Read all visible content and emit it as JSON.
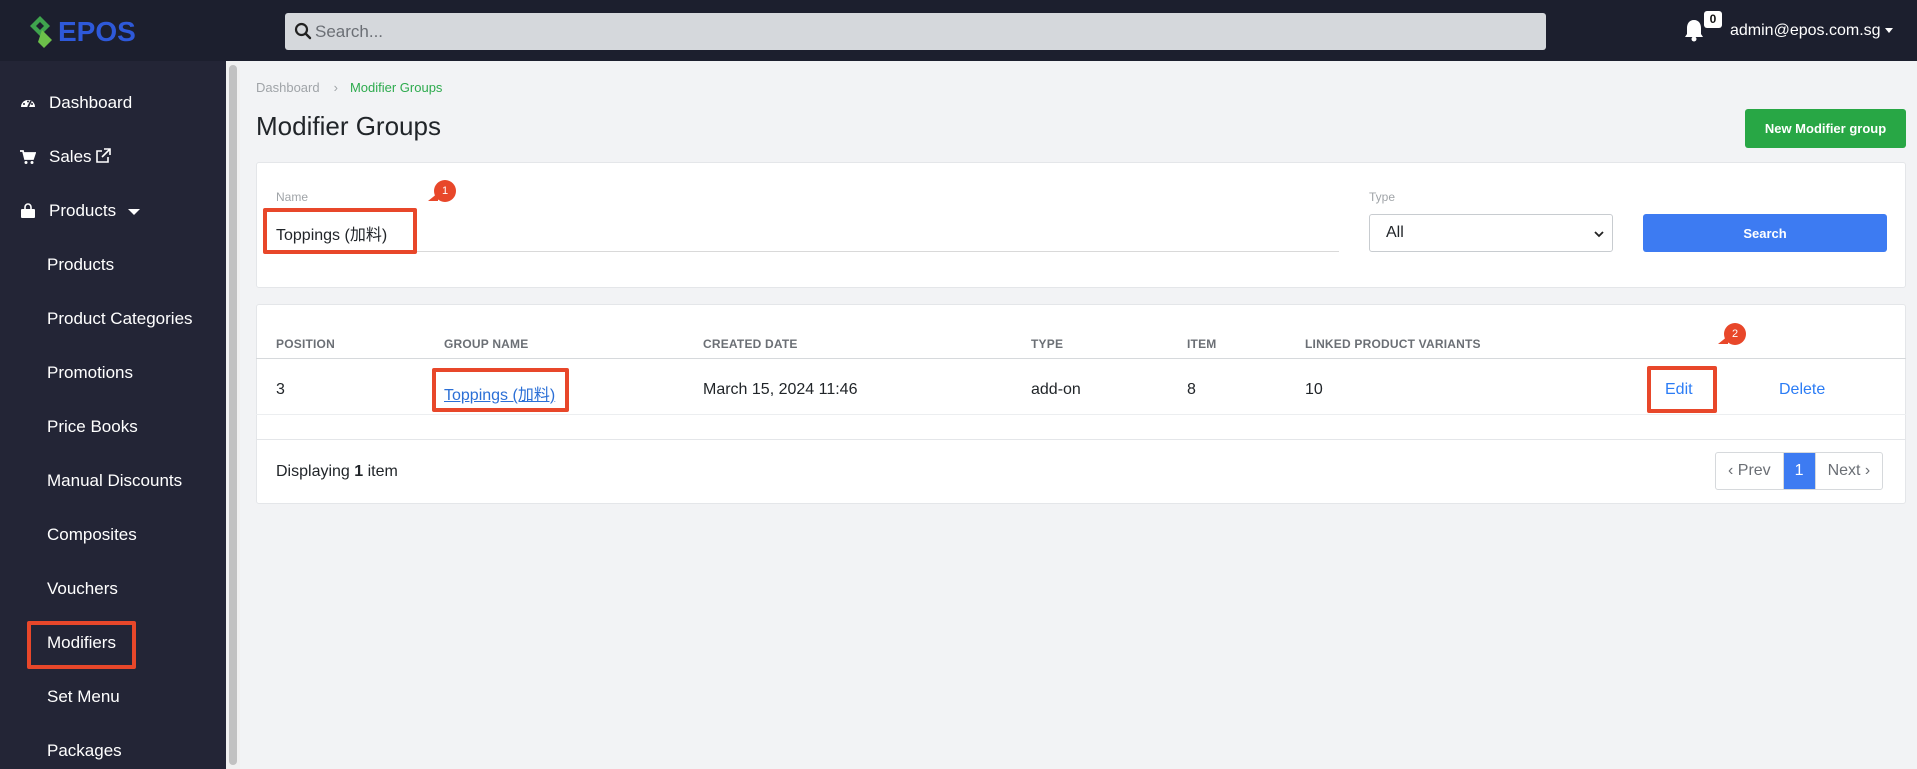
{
  "app": {
    "logo_text": "EPOS"
  },
  "topbar": {
    "search_placeholder": "Search...",
    "notification_count": "0",
    "user_email": "admin@epos.com.sg"
  },
  "sidebar": {
    "items": [
      {
        "label": "Dashboard",
        "icon": "dashboard-icon"
      },
      {
        "label": "Sales",
        "icon": "cart-icon"
      },
      {
        "label": "Products",
        "icon": "shopping-bag-icon"
      }
    ],
    "sub_items": [
      "Products",
      "Product Categories",
      "Promotions",
      "Price Books",
      "Manual Discounts",
      "Composites",
      "Vouchers",
      "Modifiers",
      "Set Menu",
      "Packages"
    ]
  },
  "breadcrumb": {
    "root": "Dashboard",
    "separator": "›",
    "current": "Modifier Groups"
  },
  "page": {
    "title": "Modifier Groups",
    "new_button": "New Modifier group"
  },
  "filters": {
    "name_label": "Name",
    "name_value": "Toppings (加料)",
    "type_label": "Type",
    "type_value": "All",
    "search_button": "Search"
  },
  "table": {
    "headers": [
      "POSITION",
      "GROUP NAME",
      "CREATED DATE",
      "TYPE",
      "ITEM",
      "LINKED PRODUCT VARIANTS"
    ],
    "rows": [
      {
        "position": "3",
        "group_name": "Toppings (加料)",
        "created_date": "March 15, 2024 11:46",
        "type": "add-on",
        "item": "8",
        "linked_variants": "10",
        "edit": "Edit",
        "delete": "Delete"
      }
    ]
  },
  "footer": {
    "displaying_prefix": "Displaying",
    "displaying_count": "1",
    "displaying_suffix": "item"
  },
  "pagination": {
    "prev": "‹ Prev",
    "current": "1",
    "next": "Next ›"
  },
  "annotations": {
    "marker_1": "1",
    "marker_2": "2"
  },
  "colors": {
    "topbar": "#1c1f2e",
    "sidebar": "#232536",
    "primary": "#3d7bf2",
    "success": "#28a745",
    "highlight": "#e8472a"
  }
}
